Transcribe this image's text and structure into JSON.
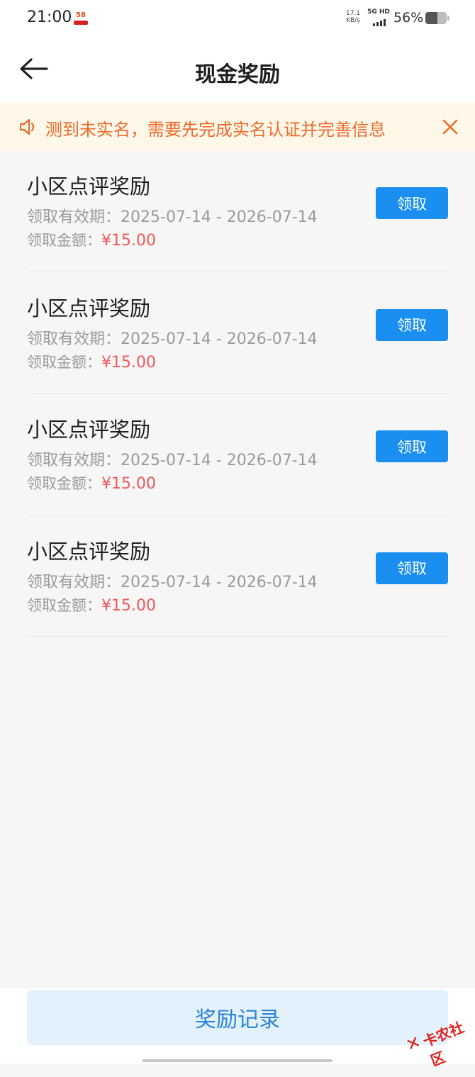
{
  "status": {
    "time": "21:00",
    "app_badge": "58",
    "net_speed_value": "17.1",
    "net_speed_unit": "KB/s",
    "network": "5G HD",
    "battery_percent": "56%",
    "battery_level": 0.56
  },
  "header": {
    "title": "现金奖励"
  },
  "notice": {
    "text": "测到未实名，需要先完成实名认证并完善信息"
  },
  "rewards": [
    {
      "title": "小区点评奖励",
      "validity_label": "领取有效期：",
      "validity": "2025-07-14 - 2026-07-14",
      "amount_label": "领取金额：",
      "amount": "¥15.00",
      "button": "领取"
    },
    {
      "title": "小区点评奖励",
      "validity_label": "领取有效期：",
      "validity": "2025-07-14 - 2026-07-14",
      "amount_label": "领取金额：",
      "amount": "¥15.00",
      "button": "领取"
    },
    {
      "title": "小区点评奖励",
      "validity_label": "领取有效期：",
      "validity": "2025-07-14 - 2026-07-14",
      "amount_label": "领取金额：",
      "amount": "¥15.00",
      "button": "领取"
    },
    {
      "title": "小区点评奖励",
      "validity_label": "领取有效期：",
      "validity": "2025-07-14 - 2026-07-14",
      "amount_label": "领取金额：",
      "amount": "¥15.00",
      "button": "领取"
    }
  ],
  "footer": {
    "record_button": "奖励记录"
  },
  "watermark": {
    "text": "卡农社区"
  },
  "colors": {
    "primary": "#1a8ff0",
    "amount": "#ef5a5a",
    "notice": "#ec6b2d",
    "notice_bg": "#fff8e8"
  },
  "icons": {
    "back": "arrow-left-icon",
    "notice": "speaker-icon",
    "close": "close-icon"
  }
}
